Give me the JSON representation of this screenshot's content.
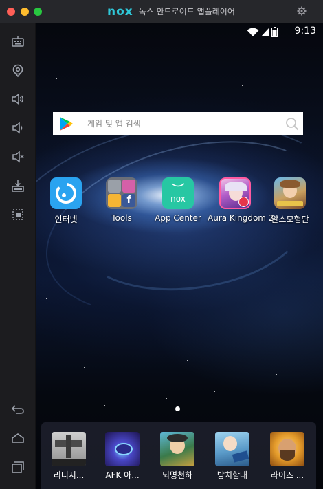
{
  "window": {
    "brand_logo": "nox",
    "title": "녹스 안드로이드 앱플레이어"
  },
  "sidebar": {
    "items": [
      {
        "name": "keyboard-icon"
      },
      {
        "name": "location-icon"
      },
      {
        "name": "volume-up-icon"
      },
      {
        "name": "volume-down-icon"
      },
      {
        "name": "mute-icon"
      },
      {
        "name": "apk-install-icon"
      },
      {
        "name": "multi-instance-icon"
      },
      {
        "name": "back-icon"
      },
      {
        "name": "home-icon"
      },
      {
        "name": "recent-apps-icon"
      }
    ]
  },
  "statusbar": {
    "time": "9:13"
  },
  "search": {
    "placeholder": "게임 및 앱 검색"
  },
  "apps": [
    {
      "label": "인터넷"
    },
    {
      "label": "Tools"
    },
    {
      "label": "App Center",
      "icon_text": "nox"
    },
    {
      "label": "Aura Kingdom 2"
    },
    {
      "label": "얄스모험단"
    }
  ],
  "dock": [
    {
      "label": "리니지..."
    },
    {
      "label": "AFK 아..."
    },
    {
      "label": "뇌명천하"
    },
    {
      "label": "방치함대"
    },
    {
      "label": "라이즈 ..."
    }
  ],
  "colors": {
    "accent": "#2fc7d8",
    "internet_icon": "#2aa3f0",
    "app_center_icon": "#27c7a3",
    "titlebar": "#26272b",
    "sidebar": "#1c1c1f"
  }
}
